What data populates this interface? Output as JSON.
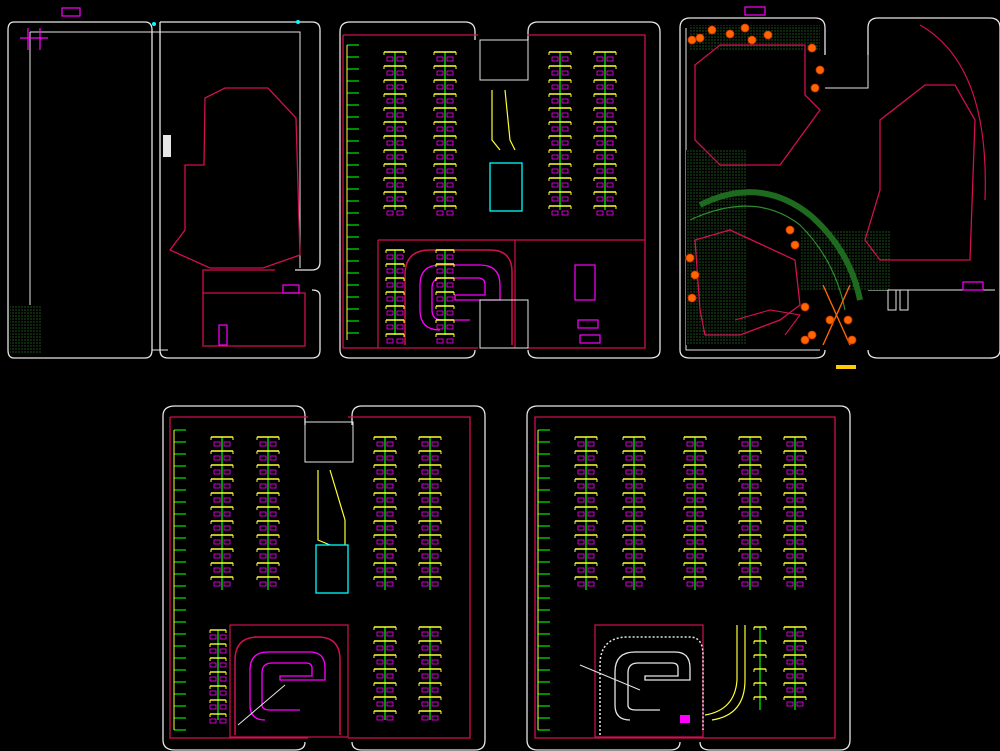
{
  "canvas": {
    "background": "#000000"
  },
  "colors": {
    "outline": "#e6e6e6",
    "magenta": "#ff00ff",
    "crimson": "#d01050",
    "green": "#00ff00",
    "yellow": "#ffff33",
    "cyan": "#00ffff",
    "orange": "#ff6600",
    "darkgreen": "#1e6a1e"
  },
  "sheets": [
    {
      "id": "site-plan",
      "label": ""
    },
    {
      "id": "basement-1",
      "label": ""
    },
    {
      "id": "landscape-plan",
      "label": ""
    },
    {
      "id": "basement-2",
      "label": ""
    },
    {
      "id": "basement-3",
      "label": ""
    }
  ]
}
